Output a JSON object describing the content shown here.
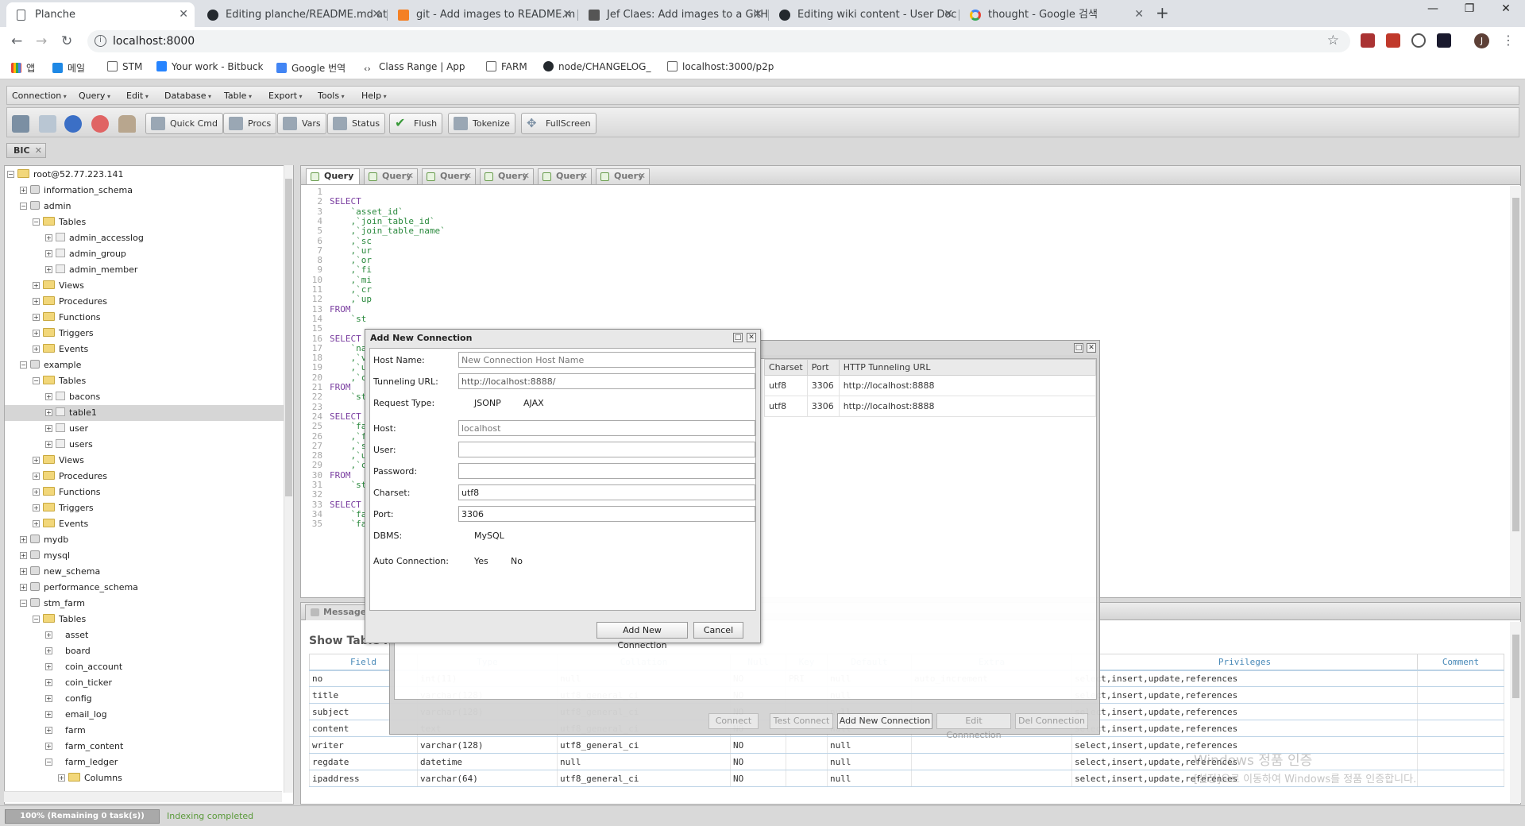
{
  "browser": {
    "tabs": [
      {
        "title": "Planche",
        "active": true
      },
      {
        "title": "Editing planche/README.md at",
        "active": false
      },
      {
        "title": "git - Add images to README.m",
        "active": false
      },
      {
        "title": "Jef Claes: Add images to a GitH",
        "active": false
      },
      {
        "title": "Editing wiki content - User Doc",
        "active": false
      },
      {
        "title": "thought - Google 검색",
        "active": false
      }
    ],
    "url": "localhost:8000",
    "profile_initial": "J",
    "bookmarks": [
      "앱",
      "메일",
      "STM",
      "Your work - Bitbuck",
      "Google 번역",
      "Class Range | App",
      "FARM",
      "node/CHANGELOG_",
      "localhost:3000/p2p"
    ]
  },
  "menu": [
    "Connection",
    "Query",
    "Edit",
    "Database",
    "Table",
    "Export",
    "Tools",
    "Help"
  ],
  "toolbar": {
    "buttons": [
      "Quick Cmd",
      "Procs",
      "Vars",
      "Status",
      "Flush",
      "Tokenize",
      "FullScreen"
    ]
  },
  "connection_tab": "BIC",
  "tree": [
    {
      "label": "root@52.77.223.141",
      "indent": 0,
      "icon": "folder",
      "exp": "−"
    },
    {
      "label": "information_schema",
      "indent": 1,
      "icon": "db",
      "exp": "+"
    },
    {
      "label": "admin",
      "indent": 1,
      "icon": "db",
      "exp": "−"
    },
    {
      "label": "Tables",
      "indent": 2,
      "icon": "folder",
      "exp": "−"
    },
    {
      "label": "admin_accesslog",
      "indent": 3,
      "icon": "tbl",
      "exp": "+"
    },
    {
      "label": "admin_group",
      "indent": 3,
      "icon": "tbl",
      "exp": "+"
    },
    {
      "label": "admin_member",
      "indent": 3,
      "icon": "tbl",
      "exp": "+"
    },
    {
      "label": "Views",
      "indent": 2,
      "icon": "folder",
      "exp": "+"
    },
    {
      "label": "Procedures",
      "indent": 2,
      "icon": "folder",
      "exp": "+"
    },
    {
      "label": "Functions",
      "indent": 2,
      "icon": "folder",
      "exp": "+"
    },
    {
      "label": "Triggers",
      "indent": 2,
      "icon": "folder",
      "exp": "+"
    },
    {
      "label": "Events",
      "indent": 2,
      "icon": "folder",
      "exp": "+"
    },
    {
      "label": "example",
      "indent": 1,
      "icon": "db",
      "exp": "−"
    },
    {
      "label": "Tables",
      "indent": 2,
      "icon": "folder",
      "exp": "−"
    },
    {
      "label": "bacons",
      "indent": 3,
      "icon": "tbl",
      "exp": "+"
    },
    {
      "label": "table1",
      "indent": 3,
      "icon": "tbl",
      "exp": "+",
      "selected": true
    },
    {
      "label": "user",
      "indent": 3,
      "icon": "tbl",
      "exp": "+"
    },
    {
      "label": "users",
      "indent": 3,
      "icon": "tbl",
      "exp": "+"
    },
    {
      "label": "Views",
      "indent": 2,
      "icon": "folder",
      "exp": "+"
    },
    {
      "label": "Procedures",
      "indent": 2,
      "icon": "folder",
      "exp": "+"
    },
    {
      "label": "Functions",
      "indent": 2,
      "icon": "folder",
      "exp": "+"
    },
    {
      "label": "Triggers",
      "indent": 2,
      "icon": "folder",
      "exp": "+"
    },
    {
      "label": "Events",
      "indent": 2,
      "icon": "folder",
      "exp": "+"
    },
    {
      "label": "mydb",
      "indent": 1,
      "icon": "db",
      "exp": "+"
    },
    {
      "label": "mysql",
      "indent": 1,
      "icon": "db",
      "exp": "+"
    },
    {
      "label": "new_schema",
      "indent": 1,
      "icon": "db",
      "exp": "+"
    },
    {
      "label": "performance_schema",
      "indent": 1,
      "icon": "db",
      "exp": "+"
    },
    {
      "label": "stm_farm",
      "indent": 1,
      "icon": "db",
      "exp": "−"
    },
    {
      "label": "Tables",
      "indent": 2,
      "icon": "folder",
      "exp": "−"
    },
    {
      "label": "asset",
      "indent": 3,
      "icon": "none",
      "exp": "+"
    },
    {
      "label": "board",
      "indent": 3,
      "icon": "none",
      "exp": "+"
    },
    {
      "label": "coin_account",
      "indent": 3,
      "icon": "none",
      "exp": "+"
    },
    {
      "label": "coin_ticker",
      "indent": 3,
      "icon": "none",
      "exp": "+"
    },
    {
      "label": "config",
      "indent": 3,
      "icon": "none",
      "exp": "+"
    },
    {
      "label": "email_log",
      "indent": 3,
      "icon": "none",
      "exp": "+"
    },
    {
      "label": "farm",
      "indent": 3,
      "icon": "none",
      "exp": "+"
    },
    {
      "label": "farm_content",
      "indent": 3,
      "icon": "none",
      "exp": "+"
    },
    {
      "label": "farm_ledger",
      "indent": 3,
      "icon": "none",
      "exp": "−"
    },
    {
      "label": "Columns",
      "indent": 4,
      "icon": "folder",
      "exp": "+"
    }
  ],
  "query_tabs": [
    "Query",
    "Query",
    "Query",
    "Query",
    "Query",
    "Query"
  ],
  "code_lines": [
    {
      "n": 1,
      "t": "",
      "c": ""
    },
    {
      "n": 2,
      "t": "SELECT",
      "c": "kw"
    },
    {
      "n": 3,
      "t": "    `asset_id`",
      "c": "col"
    },
    {
      "n": 4,
      "t": "    ,`join_table_id`",
      "c": "col"
    },
    {
      "n": 5,
      "t": "    ,`join_table_name`",
      "c": "col"
    },
    {
      "n": 6,
      "t": "    ,`sc",
      "c": "col"
    },
    {
      "n": 7,
      "t": "    ,`ur",
      "c": "col"
    },
    {
      "n": 8,
      "t": "    ,`or",
      "c": "col"
    },
    {
      "n": 9,
      "t": "    ,`fi",
      "c": "col"
    },
    {
      "n": 10,
      "t": "    ,`mi",
      "c": "col"
    },
    {
      "n": 11,
      "t": "    ,`cr",
      "c": "col"
    },
    {
      "n": 12,
      "t": "    ,`up",
      "c": "col"
    },
    {
      "n": 13,
      "t": "FROM",
      "c": "kw"
    },
    {
      "n": 14,
      "t": "    `st",
      "c": "col"
    },
    {
      "n": 15,
      "t": "",
      "c": ""
    },
    {
      "n": 16,
      "t": "SELECT",
      "c": "kw"
    },
    {
      "n": 17,
      "t": "    `na",
      "c": "col"
    },
    {
      "n": 18,
      "t": "    ,`va",
      "c": "col"
    },
    {
      "n": 19,
      "t": "    ,`up",
      "c": "col"
    },
    {
      "n": 20,
      "t": "    ,`cr",
      "c": "col"
    },
    {
      "n": 21,
      "t": "FROM",
      "c": "kw"
    },
    {
      "n": 22,
      "t": "    `st",
      "c": "col"
    },
    {
      "n": 23,
      "t": "",
      "c": ""
    },
    {
      "n": 24,
      "t": "SELECT",
      "c": "kw"
    },
    {
      "n": 25,
      "t": "    `fa",
      "c": "col"
    },
    {
      "n": 26,
      "t": "    ,`fe",
      "c": "col"
    },
    {
      "n": 27,
      "t": "    ,`st",
      "c": "col"
    },
    {
      "n": 28,
      "t": "    ,`up",
      "c": "col"
    },
    {
      "n": 29,
      "t": "    ,`cr",
      "c": "col"
    },
    {
      "n": 30,
      "t": "FROM",
      "c": "kw"
    },
    {
      "n": 31,
      "t": "    `st",
      "c": "col"
    },
    {
      "n": 32,
      "t": "",
      "c": ""
    },
    {
      "n": 33,
      "t": "SELECT",
      "c": "kw"
    },
    {
      "n": 34,
      "t": "    `farm_tr",
      "c": "col"
    },
    {
      "n": 35,
      "t": "    `farm_t",
      "c": "col"
    }
  ],
  "bottom": {
    "tab": "Messages",
    "title": "Show Table Fi",
    "headers": [
      "Field",
      "Type",
      "Collation",
      "Null",
      "Key",
      "Default",
      "Extra",
      "Privileges",
      "Comment"
    ],
    "rows": [
      [
        "no",
        "int(11)",
        "null",
        "NO",
        "PRI",
        "null",
        "auto_increment",
        "select,insert,update,references",
        ""
      ],
      [
        "title",
        "varchar(128)",
        "utf8_general_ci",
        "NO",
        "",
        "null",
        "",
        "select,insert,update,references",
        ""
      ],
      [
        "subject",
        "varchar(128)",
        "utf8_general_ci",
        "NO",
        "",
        "null",
        "",
        "select,insert,update,references",
        ""
      ],
      [
        "content",
        "text",
        "utf8_general_ci",
        "NO",
        "",
        "null",
        "",
        "select,insert,update,references",
        ""
      ],
      [
        "writer",
        "varchar(128)",
        "utf8_general_ci",
        "NO",
        "",
        "null",
        "",
        "select,insert,update,references",
        ""
      ],
      [
        "regdate",
        "datetime",
        "null",
        "NO",
        "",
        "null",
        "",
        "select,insert,update,references",
        ""
      ],
      [
        "ipaddress",
        "varchar(64)",
        "utf8_general_ci",
        "NO",
        "",
        "null",
        "",
        "select,insert,update,references",
        ""
      ]
    ]
  },
  "watermark": {
    "line1": "Windows 정품 인증",
    "line2": "[설정]으로 이동하여 Windows를 정품 인증합니다."
  },
  "status": {
    "progress": "100% (Remaining 0 task(s))",
    "text": "Indexing completed"
  },
  "conn_manager": {
    "headers": [
      "Charset",
      "Port",
      "HTTP Tunneling URL"
    ],
    "rows": [
      [
        "utf8",
        "3306",
        "http://localhost:8888"
      ],
      [
        "utf8",
        "3306",
        "http://localhost:8888"
      ]
    ],
    "buttons": [
      "Connect",
      "Test Connect",
      "Add New Connection",
      "Edit Connnection",
      "Del Connection"
    ]
  },
  "dialog": {
    "title": "Add New Connection",
    "host_name_label": "Host Name:",
    "host_name_placeholder": "New Connection Host Name",
    "tunneling_label": "Tunneling URL:",
    "tunneling_value": "http://localhost:8888/",
    "request_type_label": "Request Type:",
    "request_types": [
      "JSONP",
      "AJAX"
    ],
    "host_label": "Host:",
    "host_placeholder": "localhost",
    "user_label": "User:",
    "user_value": "",
    "password_label": "Password:",
    "password_value": "",
    "charset_label": "Charset:",
    "charset_value": "utf8",
    "port_label": "Port:",
    "port_value": "3306",
    "dbms_label": "DBMS:",
    "dbms_value": "MySQL",
    "auto_label": "Auto Connection:",
    "auto_options": [
      "Yes",
      "No"
    ],
    "add_button": "Add New Connection",
    "cancel_button": "Cancel"
  }
}
